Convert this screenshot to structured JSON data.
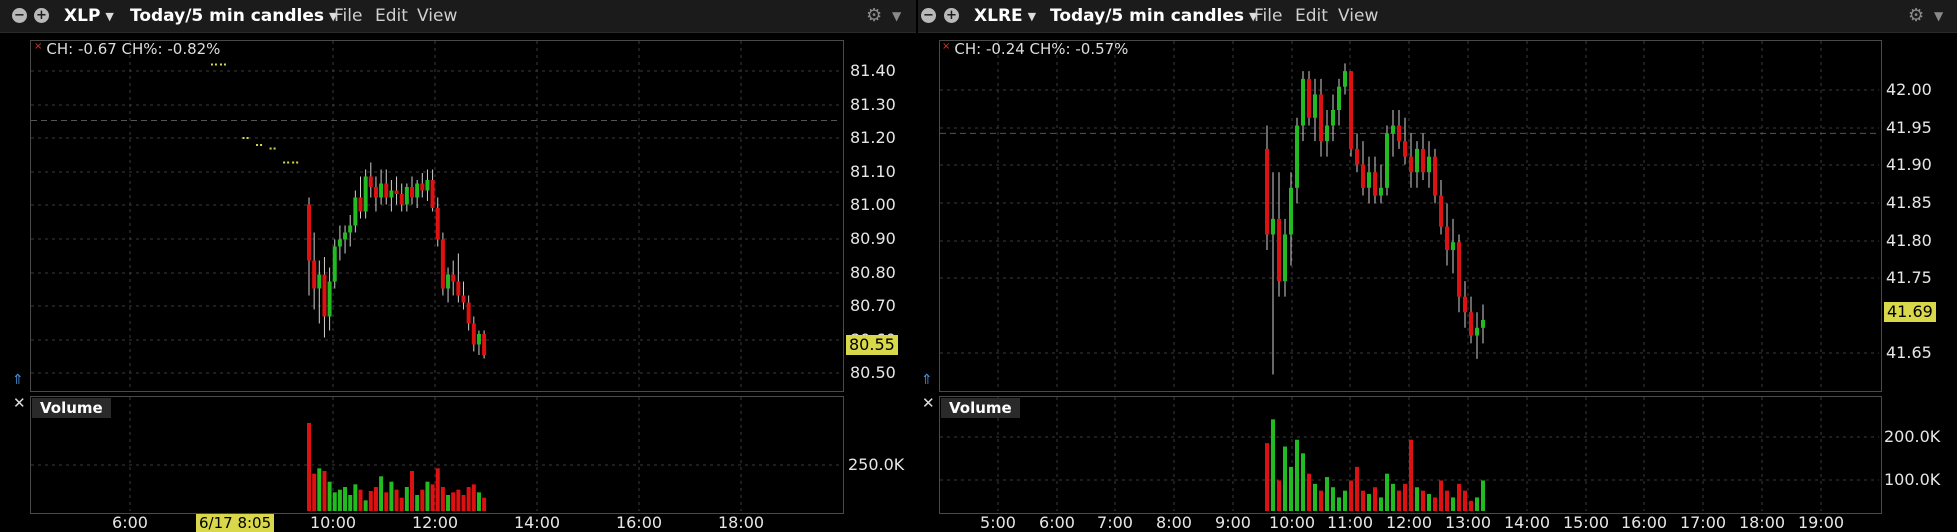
{
  "panels": [
    {
      "id": "xlp",
      "symbol": "XLP",
      "timeframe": "Today/5 min candles",
      "menu": [
        "File",
        "Edit",
        "View"
      ],
      "info_text": "CH: -0.67 CH%: -0.82%",
      "price_tag": "80.55",
      "date_tag": "6/17 8:05",
      "volume_label": "Volume",
      "y_ticks": [
        "81.40",
        "81.30",
        "81.20",
        "81.10",
        "81.00",
        "80.90",
        "80.80",
        "80.70",
        "80.60",
        "80.50"
      ],
      "x_ticks": [
        "6:00",
        "10:00",
        "12:00",
        "14:00",
        "16:00",
        "18:00"
      ],
      "volume_ticks": [
        "250.0K"
      ]
    },
    {
      "id": "xlre",
      "symbol": "XLRE",
      "timeframe": "Today/5 min candles",
      "menu": [
        "File",
        "Edit",
        "View"
      ],
      "info_text": "CH: -0.24 CH%: -0.57%",
      "price_tag": "41.69",
      "volume_label": "Volume",
      "y_ticks": [
        "42.00",
        "41.95",
        "41.90",
        "41.85",
        "41.80",
        "41.75",
        "41.65"
      ],
      "x_ticks": [
        "5:00",
        "6:00",
        "7:00",
        "8:00",
        "9:00",
        "10:00",
        "11:00",
        "12:00",
        "13:00",
        "14:00",
        "15:00",
        "16:00",
        "17:00",
        "18:00",
        "19:00"
      ],
      "volume_ticks": [
        "200.0K",
        "100.0K"
      ]
    }
  ],
  "chart_data": [
    {
      "type": "candlestick",
      "symbol": "XLP",
      "ylim": [
        80.45,
        81.45
      ],
      "x_time_range": [
        "4:30",
        "19:30"
      ],
      "prev_close": 81.22,
      "premarket_ticks": [
        {
          "t": "7:55",
          "p": 81.38
        },
        {
          "t": "8:05",
          "p": 81.38
        },
        {
          "t": "8:30",
          "p": 81.17
        },
        {
          "t": "8:45",
          "p": 81.15
        },
        {
          "t": "9:00",
          "p": 81.14
        },
        {
          "t": "9:15",
          "p": 81.1
        },
        {
          "t": "9:25",
          "p": 81.1
        }
      ],
      "candles": [
        [
          80.98,
          81.0,
          80.72,
          80.82
        ],
        [
          80.82,
          80.9,
          80.68,
          80.74
        ],
        [
          80.74,
          80.82,
          80.64,
          80.78
        ],
        [
          80.78,
          80.83,
          80.6,
          80.66
        ],
        [
          80.66,
          80.8,
          80.62,
          80.76
        ],
        [
          80.76,
          80.88,
          80.74,
          80.86
        ],
        [
          80.86,
          80.92,
          80.82,
          80.88
        ],
        [
          80.88,
          80.92,
          80.84,
          80.9
        ],
        [
          80.9,
          80.95,
          80.86,
          80.92
        ],
        [
          80.92,
          81.02,
          80.9,
          81.0
        ],
        [
          81.0,
          81.06,
          80.94,
          80.96
        ],
        [
          80.96,
          81.08,
          80.94,
          81.06
        ],
        [
          81.06,
          81.1,
          81.0,
          81.03
        ],
        [
          81.03,
          81.06,
          80.96,
          81.0
        ],
        [
          81.0,
          81.08,
          80.98,
          81.04
        ],
        [
          81.04,
          81.08,
          80.98,
          81.0
        ],
        [
          81.0,
          81.05,
          80.96,
          81.02
        ],
        [
          81.02,
          81.06,
          80.98,
          81.01
        ],
        [
          81.01,
          81.04,
          80.96,
          80.98
        ],
        [
          80.98,
          81.04,
          80.96,
          81.03
        ],
        [
          81.03,
          81.06,
          80.98,
          81.0
        ],
        [
          81.0,
          81.05,
          80.97,
          81.04
        ],
        [
          81.04,
          81.07,
          81.0,
          81.02
        ],
        [
          81.02,
          81.08,
          80.99,
          81.05
        ],
        [
          81.05,
          81.08,
          80.96,
          80.97
        ],
        [
          80.97,
          81.0,
          80.86,
          80.88
        ],
        [
          80.88,
          80.9,
          80.72,
          80.74
        ],
        [
          80.74,
          80.8,
          80.7,
          80.78
        ],
        [
          80.78,
          80.82,
          80.72,
          80.76
        ],
        [
          80.76,
          80.84,
          80.7,
          80.72
        ],
        [
          80.72,
          80.76,
          80.68,
          80.7
        ],
        [
          80.7,
          80.72,
          80.62,
          80.64
        ],
        [
          80.64,
          80.66,
          80.56,
          80.58
        ],
        [
          80.58,
          80.62,
          80.55,
          80.61
        ],
        [
          80.61,
          80.62,
          80.54,
          80.55
        ]
      ],
      "volumes_k": [
        330,
        140,
        160,
        150,
        110,
        70,
        80,
        90,
        60,
        100,
        80,
        40,
        75,
        90,
        130,
        70,
        110,
        80,
        50,
        90,
        150,
        60,
        80,
        110,
        100,
        160,
        90,
        60,
        70,
        80,
        60,
        90,
        100,
        70,
        50
      ]
    },
    {
      "type": "candlestick",
      "symbol": "XLRE",
      "ylim": [
        41.6,
        42.05
      ],
      "x_time_range": [
        "4:30",
        "19:30"
      ],
      "prev_close": 41.93,
      "candles": [
        [
          41.91,
          41.94,
          41.78,
          41.8
        ],
        [
          41.8,
          41.88,
          41.62,
          41.82
        ],
        [
          41.82,
          41.88,
          41.72,
          41.74
        ],
        [
          41.74,
          41.82,
          41.72,
          41.8
        ],
        [
          41.8,
          41.88,
          41.76,
          41.86
        ],
        [
          41.86,
          41.95,
          41.84,
          41.94
        ],
        [
          41.94,
          42.01,
          41.92,
          42.0
        ],
        [
          42.0,
          42.01,
          41.94,
          41.95
        ],
        [
          41.95,
          42.0,
          41.92,
          41.98
        ],
        [
          41.98,
          42.0,
          41.9,
          41.92
        ],
        [
          41.92,
          41.96,
          41.9,
          41.94
        ],
        [
          41.94,
          41.98,
          41.92,
          41.96
        ],
        [
          41.96,
          42.0,
          41.94,
          41.99
        ],
        [
          41.99,
          42.02,
          41.98,
          42.01
        ],
        [
          42.01,
          42.01,
          41.9,
          41.91
        ],
        [
          41.91,
          41.93,
          41.88,
          41.89
        ],
        [
          41.89,
          41.92,
          41.85,
          41.86
        ],
        [
          41.86,
          41.9,
          41.84,
          41.88
        ],
        [
          41.88,
          41.9,
          41.84,
          41.85
        ],
        [
          41.85,
          41.89,
          41.84,
          41.86
        ],
        [
          41.86,
          41.94,
          41.85,
          41.93
        ],
        [
          41.93,
          41.96,
          41.9,
          41.94
        ],
        [
          41.94,
          41.96,
          41.91,
          41.92
        ],
        [
          41.92,
          41.95,
          41.89,
          41.9
        ],
        [
          41.9,
          41.93,
          41.86,
          41.88
        ],
        [
          41.88,
          41.92,
          41.86,
          41.91
        ],
        [
          41.91,
          41.93,
          41.87,
          41.88
        ],
        [
          41.88,
          41.92,
          41.86,
          41.9
        ],
        [
          41.9,
          41.91,
          41.84,
          41.85
        ],
        [
          41.85,
          41.87,
          41.8,
          41.81
        ],
        [
          41.81,
          41.84,
          41.76,
          41.78
        ],
        [
          41.78,
          41.82,
          41.75,
          41.79
        ],
        [
          41.79,
          41.8,
          41.7,
          41.72
        ],
        [
          41.72,
          41.74,
          41.68,
          41.7
        ],
        [
          41.7,
          41.72,
          41.66,
          41.67
        ],
        [
          41.67,
          41.7,
          41.64,
          41.68
        ],
        [
          41.68,
          41.71,
          41.66,
          41.69
        ]
      ],
      "volumes_k": [
        200,
        270,
        90,
        190,
        130,
        210,
        170,
        110,
        80,
        60,
        100,
        70,
        40,
        60,
        90,
        130,
        60,
        50,
        70,
        40,
        110,
        80,
        60,
        80,
        210,
        70,
        60,
        50,
        40,
        90,
        60,
        40,
        80,
        60,
        30,
        40,
        90
      ]
    }
  ],
  "colors": {
    "up": "#22bb22",
    "down": "#dd1111",
    "grid": "#3a3a3a",
    "tag": "#d8d84a",
    "premarket": "#d8d84a"
  }
}
